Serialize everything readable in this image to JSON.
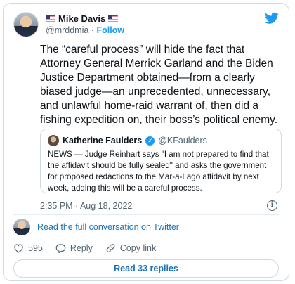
{
  "author": {
    "name": "Mike Davis",
    "handle": "@mrddmia",
    "separator": "·",
    "follow_label": "Follow"
  },
  "tweet": {
    "text": "The “careful process” will hide the fact that Attorney General Merrick Garland and the Biden Justice Department obtained—from a clearly biased judge—an unprecedented, unnecessary, and unlawful home-raid warrant of, then did a fishing expedition on, their boss’s political enemy.",
    "timestamp": "2:35 PM · Aug 18, 2022"
  },
  "quoted": {
    "name": "Katherine Faulders",
    "handle": "@KFaulders",
    "text": "NEWS — Judge Reinhart says \"I am not prepared to find that the affidavit should be fully sealed\" and asks the government for proposed redactions to the Mar-a-Lago affidavit by next week, adding this will be a careful process."
  },
  "conversation": {
    "link_label": "Read the full conversation on Twitter"
  },
  "actions": {
    "like_count": "595",
    "reply_label": "Reply",
    "copy_label": "Copy link"
  },
  "replies_button": "Read 33 replies",
  "icons": {
    "brand": "twitter-bird-icon",
    "flag": "us-flag-icon",
    "verified": "verified-badge-icon",
    "info": "info-icon",
    "like": "heart-icon",
    "reply": "speech-bubble-icon",
    "copy": "link-icon"
  },
  "colors": {
    "accent": "#1d9bf0",
    "link": "#1d73b7",
    "text": "#0f1419",
    "muted": "#536471",
    "border": "#cfd9de"
  }
}
